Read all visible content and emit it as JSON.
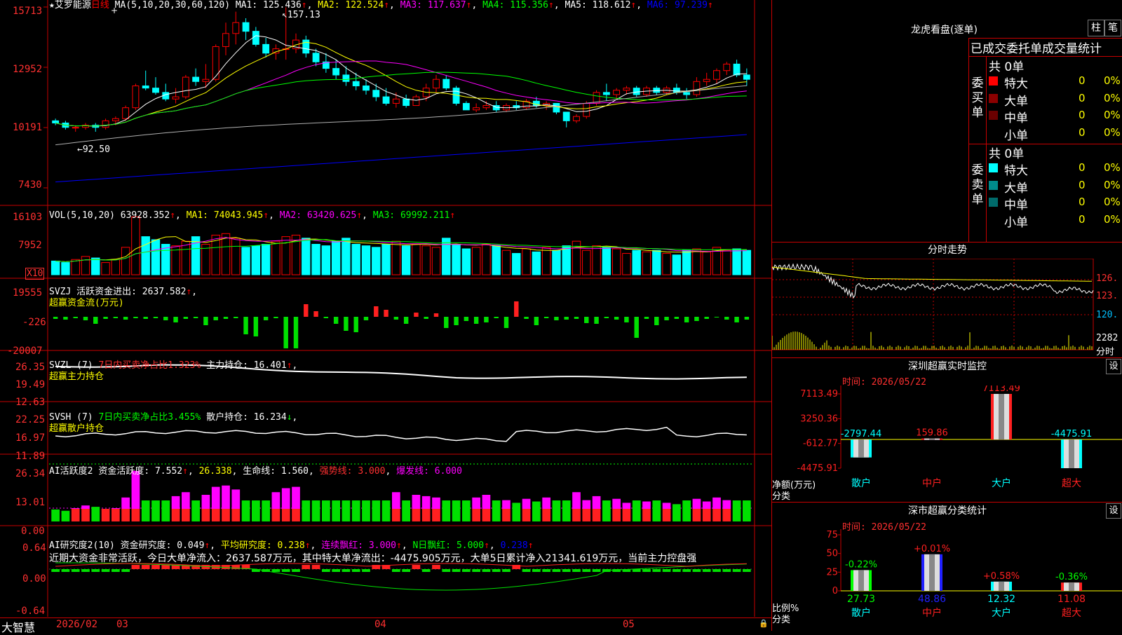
{
  "colors": {
    "up": "#ff0000",
    "down": "#00ffff",
    "red": "#ff2020",
    "green": "#00e000",
    "cyan": "#00ffff",
    "yellow": "#ffff00",
    "magenta": "#ff00ff",
    "white": "#ffffff",
    "grid": "#990000",
    "axis": "#c80000",
    "ma_green": "#00ff00",
    "ma_blue": "#0000ff",
    "gray": "#b0b0b0",
    "volbar_dark": "#8b0000",
    "label": "#dddddd"
  },
  "header": {
    "stock": "★艾罗能源",
    "period": "日线",
    "ma_label": "MA(5,10,20,30,60,120)",
    "ma1": "MA1: 125.436",
    "ma2": "MA2: 122.524",
    "ma3": "MA3: 117.637",
    "ma4": "MA4: 115.356",
    "ma5": "MA5: 118.612",
    "ma6": "MA6: 97.239",
    "high_mark": "157.13",
    "low_mark": "92.50"
  },
  "price_axis": [
    "15713",
    "12952",
    "10191",
    "7430"
  ],
  "vol": {
    "label": "VOL(5,10,20)",
    "value": "63928.352",
    "ma1": "MA1: 74043.945",
    "ma2": "MA2: 63420.625",
    "ma3": "MA3: 69992.211",
    "axis": [
      "16103",
      "7952"
    ],
    "unit": "X10"
  },
  "svzj": {
    "label": "SVZJ",
    "text": "活跃资金进出: 2637.582",
    "sub": "超赢资金流(万元)",
    "axis": [
      "19555",
      "-226",
      "-20007"
    ]
  },
  "svzl": {
    "label": "SVZL (7)",
    "text1": "7日内买卖净占比1.323%",
    "text2": "主力持仓: 16.401",
    "sub": "超赢主力持仓",
    "axis": [
      "26.35",
      "19.49",
      "12.63"
    ]
  },
  "svsh": {
    "label": "SVSH (7)",
    "text1": "7日内买卖净占比3.455%",
    "text2": "散户持仓: 16.234",
    "sub": "超赢散户持仓",
    "axis": [
      "22.25",
      "16.97",
      "11.89"
    ]
  },
  "ai1": {
    "label": "AI活跃度2",
    "text1": "资金活跃度: 7.552",
    "text2": "26.338",
    "text3": "生命线: 1.560",
    "text4": "强势线: 3.000",
    "text5": "爆发线: 6.000",
    "axis": [
      "26.34",
      "13.01",
      "0.00"
    ]
  },
  "ai2": {
    "label": "AI研究度2(10)",
    "text1": "资金研究度: 0.049",
    "text2": "平均研究度: 0.238",
    "text3": "连续飘红: 3.000",
    "text4": "N日飘红: 5.000",
    "text5": "0.238",
    "axis": [
      "0.64",
      "0.00",
      "-0.64"
    ],
    "note": "近期大资金非常活跃，今日大单净流入：2637.587万元，其中特大单净流出：-4475.905万元，大单5日累计净入21341.619万元，当前主力控盘强"
  },
  "date_axis": {
    "brand": "大智慧",
    "labels": [
      "2026/02",
      "03",
      "04",
      "05"
    ]
  },
  "right": {
    "title": "龙虎看盘(逐单)",
    "btn1": "柱",
    "btn2": "笔",
    "table_title": "已成交委托单成交量统计",
    "buy_label": "委买单",
    "sell_label": "委卖单",
    "buy_total": "共 0单",
    "sell_total": "共 0单",
    "buy_rows": [
      {
        "name": "特大",
        "val": "0",
        "pct": "0%",
        "color": "#ff0000"
      },
      {
        "name": "大单",
        "val": "0",
        "pct": "0%",
        "color": "#8b0000"
      },
      {
        "name": "中单",
        "val": "0",
        "pct": "0%",
        "color": "#6b0000"
      },
      {
        "name": "小单",
        "val": "0",
        "pct": "0%",
        "color": ""
      }
    ],
    "sell_rows": [
      {
        "name": "特大",
        "val": "0",
        "pct": "0%",
        "color": "#00ffff"
      },
      {
        "name": "大单",
        "val": "0",
        "pct": "0%",
        "color": "#008b8b"
      },
      {
        "name": "中单",
        "val": "0",
        "pct": "0%",
        "color": "#006b6b"
      },
      {
        "name": "小单",
        "val": "0",
        "pct": "0%",
        "color": ""
      }
    ],
    "intraday_title": "分时走势",
    "intraday_axis": [
      "126.",
      "123.",
      "120."
    ],
    "intraday_vol": [
      "2282",
      "分时"
    ],
    "monitor_title": "深圳超赢实时监控",
    "monitor_btn": "设",
    "monitor_time": "时间: 2026/05/22",
    "monitor_axis": [
      "7113.49",
      "3250.36",
      "-612.77",
      "-4475.91"
    ],
    "monitor_ylabel1": "净额(万元)",
    "monitor_ylabel2": "分类",
    "monitor_cats": [
      "散户",
      "中户",
      "大户",
      "超大"
    ],
    "monitor_vals": [
      -2797.44,
      159.86,
      7113.49,
      -4475.91
    ],
    "monitor_val_labels": [
      "-2797.44",
      "159.86",
      "7113.49",
      "-4475.91"
    ],
    "class_title": "深市超赢分类统计",
    "class_btn": "设",
    "class_time": "时间: 2026/05/22",
    "class_axis": [
      "75",
      "50",
      "25",
      "0"
    ],
    "class_ylabel1": "比例%",
    "class_ylabel2": "分类",
    "class_cats": [
      "散户",
      "中户",
      "大户",
      "超大"
    ],
    "class_vals": [
      27.73,
      48.86,
      12.32,
      11.08
    ],
    "class_val_labels": [
      "27.73",
      "48.86",
      "12.32",
      "11.08"
    ],
    "class_changes": [
      "-0.22%",
      "+0.01%",
      "+0.58%",
      "-0.36%"
    ]
  },
  "chart_data": {
    "type": "candlestick",
    "candles": [
      [
        105,
        106,
        103,
        104
      ],
      [
        104,
        105,
        101,
        102
      ],
      [
        102,
        103,
        100,
        102
      ],
      [
        102,
        104,
        101,
        103
      ],
      [
        103,
        104,
        100,
        102
      ],
      [
        102,
        106,
        101,
        105
      ],
      [
        105,
        107,
        103,
        106
      ],
      [
        106,
        112,
        105,
        111
      ],
      [
        111,
        122,
        110,
        121
      ],
      [
        121,
        128,
        119,
        120
      ],
      [
        120,
        125,
        117,
        118
      ],
      [
        118,
        122,
        114,
        115
      ],
      [
        115,
        120,
        113,
        116
      ],
      [
        116,
        126,
        115,
        125
      ],
      [
        125,
        129,
        121,
        123
      ],
      [
        123,
        131,
        120,
        124
      ],
      [
        124,
        140,
        123,
        139
      ],
      [
        139,
        150,
        135,
        145
      ],
      [
        145,
        155,
        140,
        150
      ],
      [
        150,
        152,
        142,
        146
      ],
      [
        146,
        148,
        139,
        140
      ],
      [
        140,
        143,
        134,
        136
      ],
      [
        136,
        140,
        133,
        138
      ],
      [
        138,
        157,
        133,
        138
      ],
      [
        138,
        145,
        136,
        142
      ],
      [
        142,
        144,
        134,
        136
      ],
      [
        136,
        138,
        130,
        132
      ],
      [
        132,
        136,
        127,
        129
      ],
      [
        129,
        133,
        124,
        126
      ],
      [
        126,
        130,
        121,
        123
      ],
      [
        123,
        127,
        119,
        121
      ],
      [
        121,
        124,
        117,
        119
      ],
      [
        119,
        122,
        114,
        116
      ],
      [
        116,
        120,
        112,
        113
      ],
      [
        113,
        118,
        111,
        115
      ],
      [
        115,
        117,
        111,
        112
      ],
      [
        112,
        117,
        112,
        116
      ],
      [
        116,
        122,
        114,
        120
      ],
      [
        120,
        126,
        118,
        124
      ],
      [
        124,
        126,
        119,
        120
      ],
      [
        120,
        121,
        112,
        113
      ],
      [
        113,
        114,
        110,
        110
      ],
      [
        110,
        113,
        109,
        111
      ],
      [
        111,
        114,
        110,
        112
      ],
      [
        112,
        114,
        109,
        110
      ],
      [
        110,
        113,
        109,
        112
      ],
      [
        112,
        114,
        110,
        111
      ],
      [
        111,
        115,
        110,
        114
      ],
      [
        114,
        116,
        111,
        112
      ],
      [
        112,
        114,
        110,
        113
      ],
      [
        113,
        113,
        108,
        109
      ],
      [
        109,
        109,
        102,
        105
      ],
      [
        105,
        108,
        104,
        107
      ],
      [
        107,
        114,
        106,
        113
      ],
      [
        113,
        119,
        112,
        118
      ],
      [
        118,
        122,
        114,
        117
      ],
      [
        117,
        120,
        115,
        119
      ],
      [
        119,
        121,
        117,
        120
      ],
      [
        120,
        121,
        116,
        117
      ],
      [
        117,
        121,
        116,
        120
      ],
      [
        120,
        121,
        117,
        118
      ],
      [
        118,
        121,
        117,
        120
      ],
      [
        120,
        122,
        117,
        118
      ],
      [
        118,
        120,
        115,
        117
      ],
      [
        117,
        125,
        116,
        123
      ],
      [
        123,
        127,
        121,
        124
      ],
      [
        124,
        129,
        122,
        128
      ],
      [
        128,
        132,
        126,
        131
      ],
      [
        131,
        133,
        125,
        126
      ],
      [
        126,
        129,
        121,
        124
      ]
    ],
    "ma_lines": [
      {
        "name": "MA1",
        "value": 125.436
      },
      {
        "name": "MA2",
        "value": 122.524
      },
      {
        "name": "MA3",
        "value": 117.637
      },
      {
        "name": "MA4",
        "value": 115.356
      },
      {
        "name": "MA5",
        "value": 118.612
      },
      {
        "name": "MA6",
        "value": 97.239
      }
    ],
    "ylim": [
      74.3,
      157.13
    ],
    "volume": [
      45,
      40,
      50,
      60,
      55,
      40,
      50,
      90,
      190,
      125,
      115,
      100,
      95,
      110,
      125,
      100,
      130,
      135,
      120,
      90,
      95,
      100,
      110,
      125,
      130,
      120,
      100,
      95,
      110,
      120,
      100,
      95,
      90,
      100,
      110,
      95,
      100,
      95,
      90,
      120,
      100,
      85,
      90,
      100,
      95,
      80,
      70,
      85,
      75,
      90,
      80,
      95,
      110,
      80,
      95,
      90,
      85,
      70,
      80,
      75,
      80,
      70,
      65,
      80,
      85,
      75,
      90,
      80,
      85,
      80
    ],
    "svzj": [
      -3,
      -4,
      -2,
      -5,
      -10,
      -3,
      -2,
      -4,
      -2,
      -3,
      -2,
      -5,
      -8,
      -3,
      -2,
      -12,
      -5,
      -3,
      -2,
      -25,
      -28,
      -5,
      -2,
      45,
      45,
      -6,
      -4,
      -2,
      -10,
      -20,
      -22,
      -5,
      -4,
      -2,
      -4,
      -10,
      -5,
      -3,
      -8,
      -16,
      -12,
      -6,
      -10,
      -8,
      -2,
      -16,
      -6,
      -3,
      -12,
      -2,
      -5,
      -4,
      -3,
      -9,
      -10,
      -2,
      -4,
      -8,
      -30,
      -3,
      -12,
      -5,
      -3,
      -8,
      -6,
      -3,
      -1,
      -4,
      -8,
      -4
    ],
    "svzj_up": [
      0,
      0,
      0,
      0,
      0,
      0,
      0,
      0,
      0,
      0,
      0,
      0,
      0,
      0,
      0,
      0,
      0,
      0,
      0,
      0,
      0,
      0,
      0,
      0,
      0,
      18,
      8,
      0,
      0,
      0,
      0,
      0,
      15,
      10,
      0,
      0,
      6,
      0,
      5,
      0,
      0,
      0,
      0,
      0,
      0,
      0,
      22,
      0,
      0,
      0,
      0,
      0,
      0,
      0,
      0,
      0,
      0,
      0,
      0,
      0,
      0,
      0,
      0,
      0,
      0,
      0,
      0,
      0,
      0,
      0
    ]
  }
}
